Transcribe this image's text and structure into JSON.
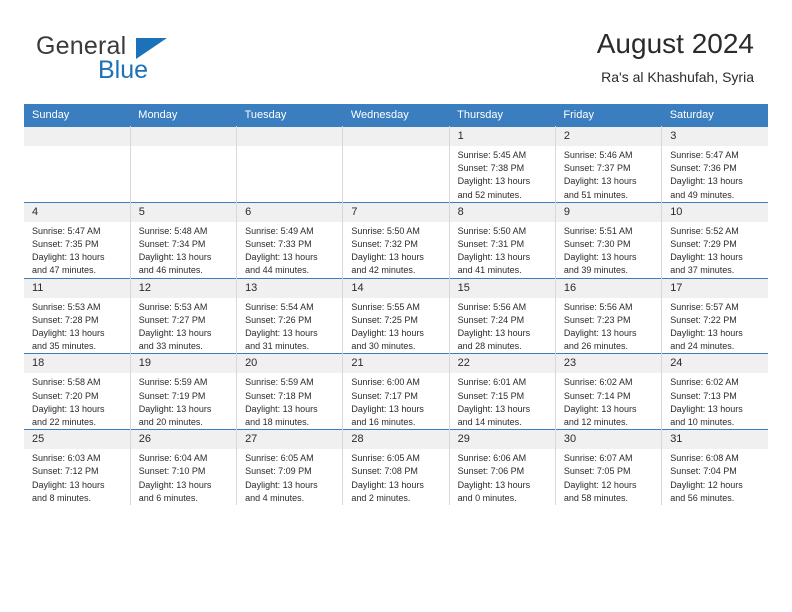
{
  "brand": {
    "word1": "General",
    "word2": "Blue",
    "accent_color": "#1b72b8",
    "triangle_icon": "brand-triangle-icon"
  },
  "header": {
    "title": "August 2024",
    "subtitle": "Ra's al Khashufah, Syria"
  },
  "theme": {
    "header_bg": "#3a7ebf",
    "daynum_bg": "#f0f0f0",
    "grid_line": "#d8d8d8",
    "text": "#2b2b2b"
  },
  "weekdays": [
    "Sunday",
    "Monday",
    "Tuesday",
    "Wednesday",
    "Thursday",
    "Friday",
    "Saturday"
  ],
  "weeks": [
    [
      {
        "day": "",
        "empty": true,
        "lines": []
      },
      {
        "day": "",
        "empty": true,
        "lines": []
      },
      {
        "day": "",
        "empty": true,
        "lines": []
      },
      {
        "day": "",
        "empty": true,
        "lines": []
      },
      {
        "day": "1",
        "empty": false,
        "lines": [
          "Sunrise: 5:45 AM",
          "Sunset: 7:38 PM",
          "Daylight: 13 hours",
          "and 52 minutes."
        ]
      },
      {
        "day": "2",
        "empty": false,
        "lines": [
          "Sunrise: 5:46 AM",
          "Sunset: 7:37 PM",
          "Daylight: 13 hours",
          "and 51 minutes."
        ]
      },
      {
        "day": "3",
        "empty": false,
        "lines": [
          "Sunrise: 5:47 AM",
          "Sunset: 7:36 PM",
          "Daylight: 13 hours",
          "and 49 minutes."
        ]
      }
    ],
    [
      {
        "day": "4",
        "empty": false,
        "lines": [
          "Sunrise: 5:47 AM",
          "Sunset: 7:35 PM",
          "Daylight: 13 hours",
          "and 47 minutes."
        ]
      },
      {
        "day": "5",
        "empty": false,
        "lines": [
          "Sunrise: 5:48 AM",
          "Sunset: 7:34 PM",
          "Daylight: 13 hours",
          "and 46 minutes."
        ]
      },
      {
        "day": "6",
        "empty": false,
        "lines": [
          "Sunrise: 5:49 AM",
          "Sunset: 7:33 PM",
          "Daylight: 13 hours",
          "and 44 minutes."
        ]
      },
      {
        "day": "7",
        "empty": false,
        "lines": [
          "Sunrise: 5:50 AM",
          "Sunset: 7:32 PM",
          "Daylight: 13 hours",
          "and 42 minutes."
        ]
      },
      {
        "day": "8",
        "empty": false,
        "lines": [
          "Sunrise: 5:50 AM",
          "Sunset: 7:31 PM",
          "Daylight: 13 hours",
          "and 41 minutes."
        ]
      },
      {
        "day": "9",
        "empty": false,
        "lines": [
          "Sunrise: 5:51 AM",
          "Sunset: 7:30 PM",
          "Daylight: 13 hours",
          "and 39 minutes."
        ]
      },
      {
        "day": "10",
        "empty": false,
        "lines": [
          "Sunrise: 5:52 AM",
          "Sunset: 7:29 PM",
          "Daylight: 13 hours",
          "and 37 minutes."
        ]
      }
    ],
    [
      {
        "day": "11",
        "empty": false,
        "lines": [
          "Sunrise: 5:53 AM",
          "Sunset: 7:28 PM",
          "Daylight: 13 hours",
          "and 35 minutes."
        ]
      },
      {
        "day": "12",
        "empty": false,
        "lines": [
          "Sunrise: 5:53 AM",
          "Sunset: 7:27 PM",
          "Daylight: 13 hours",
          "and 33 minutes."
        ]
      },
      {
        "day": "13",
        "empty": false,
        "lines": [
          "Sunrise: 5:54 AM",
          "Sunset: 7:26 PM",
          "Daylight: 13 hours",
          "and 31 minutes."
        ]
      },
      {
        "day": "14",
        "empty": false,
        "lines": [
          "Sunrise: 5:55 AM",
          "Sunset: 7:25 PM",
          "Daylight: 13 hours",
          "and 30 minutes."
        ]
      },
      {
        "day": "15",
        "empty": false,
        "lines": [
          "Sunrise: 5:56 AM",
          "Sunset: 7:24 PM",
          "Daylight: 13 hours",
          "and 28 minutes."
        ]
      },
      {
        "day": "16",
        "empty": false,
        "lines": [
          "Sunrise: 5:56 AM",
          "Sunset: 7:23 PM",
          "Daylight: 13 hours",
          "and 26 minutes."
        ]
      },
      {
        "day": "17",
        "empty": false,
        "lines": [
          "Sunrise: 5:57 AM",
          "Sunset: 7:22 PM",
          "Daylight: 13 hours",
          "and 24 minutes."
        ]
      }
    ],
    [
      {
        "day": "18",
        "empty": false,
        "lines": [
          "Sunrise: 5:58 AM",
          "Sunset: 7:20 PM",
          "Daylight: 13 hours",
          "and 22 minutes."
        ]
      },
      {
        "day": "19",
        "empty": false,
        "lines": [
          "Sunrise: 5:59 AM",
          "Sunset: 7:19 PM",
          "Daylight: 13 hours",
          "and 20 minutes."
        ]
      },
      {
        "day": "20",
        "empty": false,
        "lines": [
          "Sunrise: 5:59 AM",
          "Sunset: 7:18 PM",
          "Daylight: 13 hours",
          "and 18 minutes."
        ]
      },
      {
        "day": "21",
        "empty": false,
        "lines": [
          "Sunrise: 6:00 AM",
          "Sunset: 7:17 PM",
          "Daylight: 13 hours",
          "and 16 minutes."
        ]
      },
      {
        "day": "22",
        "empty": false,
        "lines": [
          "Sunrise: 6:01 AM",
          "Sunset: 7:15 PM",
          "Daylight: 13 hours",
          "and 14 minutes."
        ]
      },
      {
        "day": "23",
        "empty": false,
        "lines": [
          "Sunrise: 6:02 AM",
          "Sunset: 7:14 PM",
          "Daylight: 13 hours",
          "and 12 minutes."
        ]
      },
      {
        "day": "24",
        "empty": false,
        "lines": [
          "Sunrise: 6:02 AM",
          "Sunset: 7:13 PM",
          "Daylight: 13 hours",
          "and 10 minutes."
        ]
      }
    ],
    [
      {
        "day": "25",
        "empty": false,
        "lines": [
          "Sunrise: 6:03 AM",
          "Sunset: 7:12 PM",
          "Daylight: 13 hours",
          "and 8 minutes."
        ]
      },
      {
        "day": "26",
        "empty": false,
        "lines": [
          "Sunrise: 6:04 AM",
          "Sunset: 7:10 PM",
          "Daylight: 13 hours",
          "and 6 minutes."
        ]
      },
      {
        "day": "27",
        "empty": false,
        "lines": [
          "Sunrise: 6:05 AM",
          "Sunset: 7:09 PM",
          "Daylight: 13 hours",
          "and 4 minutes."
        ]
      },
      {
        "day": "28",
        "empty": false,
        "lines": [
          "Sunrise: 6:05 AM",
          "Sunset: 7:08 PM",
          "Daylight: 13 hours",
          "and 2 minutes."
        ]
      },
      {
        "day": "29",
        "empty": false,
        "lines": [
          "Sunrise: 6:06 AM",
          "Sunset: 7:06 PM",
          "Daylight: 13 hours",
          "and 0 minutes."
        ]
      },
      {
        "day": "30",
        "empty": false,
        "lines": [
          "Sunrise: 6:07 AM",
          "Sunset: 7:05 PM",
          "Daylight: 12 hours",
          "and 58 minutes."
        ]
      },
      {
        "day": "31",
        "empty": false,
        "lines": [
          "Sunrise: 6:08 AM",
          "Sunset: 7:04 PM",
          "Daylight: 12 hours",
          "and 56 minutes."
        ]
      }
    ]
  ]
}
